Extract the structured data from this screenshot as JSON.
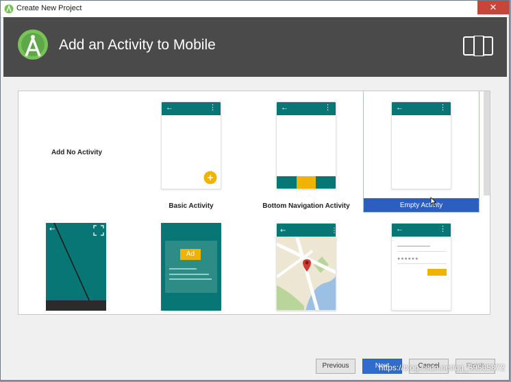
{
  "window": {
    "title": "Create New Project",
    "close_glyph": "✕",
    "app_icon": "android-studio-icon"
  },
  "header": {
    "title": "Add an Activity to Mobile",
    "logo_icon": "android-studio-logo-icon",
    "device_icon": "phone-tablet-icon"
  },
  "templates": [
    {
      "label": "Add No Activity"
    },
    {
      "label": "Basic Activity"
    },
    {
      "label": "Bottom Navigation Activity"
    },
    {
      "label": "Empty Activity",
      "selected": true
    },
    {
      "label": ""
    },
    {
      "label": ""
    },
    {
      "label": ""
    },
    {
      "label": ""
    }
  ],
  "ad_badge": "Ad",
  "footer": {
    "previous": "Previous",
    "next": "Next",
    "cancel": "Cancel",
    "finish": "Finish"
  },
  "watermark": "https://blog.csdn.net/qq_39565872",
  "colors": {
    "teal": "#077674",
    "accent": "#f0b400",
    "header_bg": "#4a4a4a",
    "selection": "#2a5fc0"
  }
}
